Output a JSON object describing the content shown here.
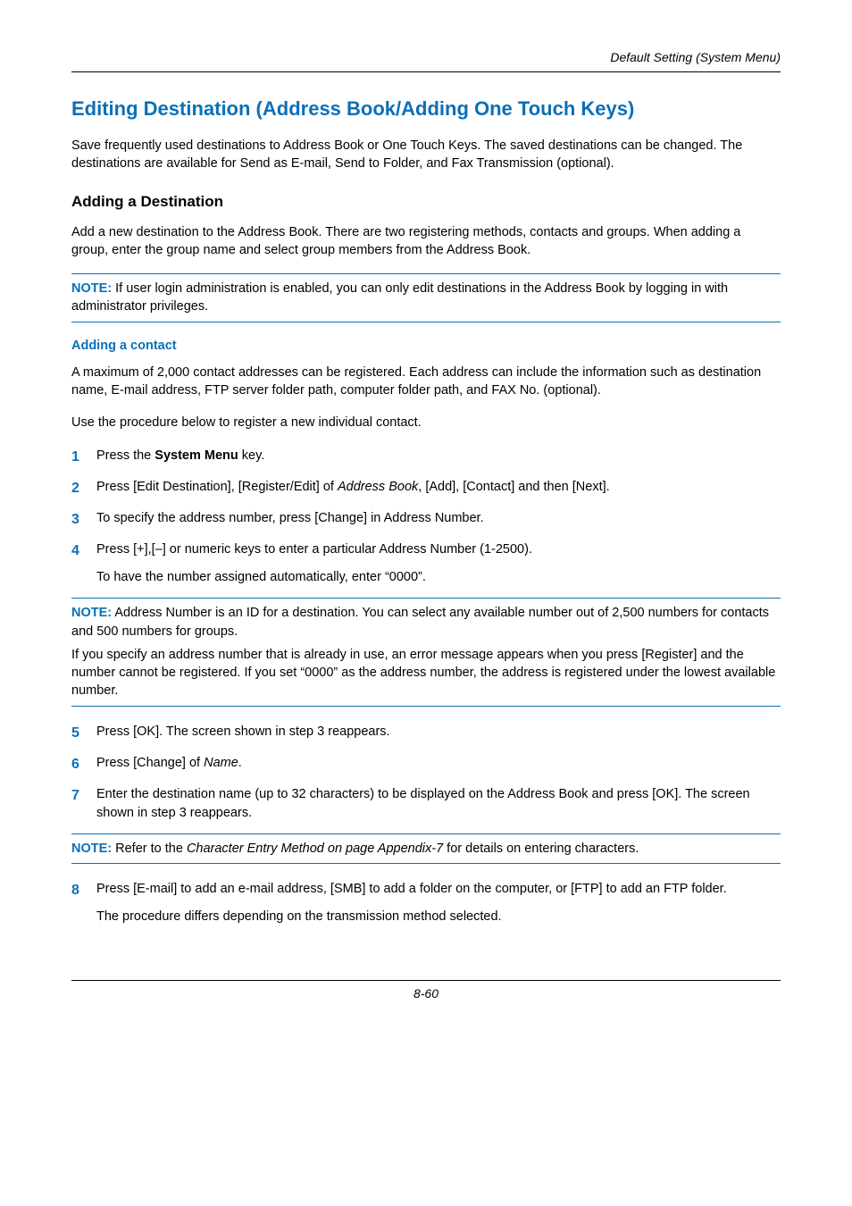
{
  "running_header": "Default Setting (System Menu)",
  "title": "Editing Destination (Address Book/Adding One Touch Keys)",
  "intro": "Save frequently used destinations to Address Book or One Touch Keys. The saved destinations can be changed. The destinations are available for Send as E-mail, Send to Folder, and Fax Transmission (optional).",
  "sub_title": "Adding a Destination",
  "sub_intro": "Add a new destination to the Address Book. There are two registering methods, contacts and groups. When adding a group, enter the group name and select group members from the Address Book.",
  "note1_label": "NOTE:",
  "note1_text": " If user login administration is enabled, you can only edit destinations in the Address Book by logging in with administrator privileges.",
  "blue_sub": "Adding a contact",
  "contact_p1": "A maximum of 2,000 contact addresses can be registered. Each address can include the information such as destination name, E-mail address, FTP server folder path, computer folder path, and FAX No. (optional).",
  "contact_p2": "Use the procedure below to register a new individual contact.",
  "steps_a": {
    "1": {
      "pre": "Press the ",
      "bold": "System Menu",
      "post": " key."
    },
    "2": {
      "pre": "Press [Edit Destination], [Register/Edit] of ",
      "ital": "Address Book",
      "post": ", [Add], [Contact] and then [Next]."
    },
    "3": "To specify the address number, press [Change] in Address Number.",
    "4_p1": "Press [+],[–] or numeric keys to enter a particular Address Number (1-2500).",
    "4_p2": "To have the number assigned automatically, enter “0000”."
  },
  "note2_label": "NOTE:",
  "note2_p1": " Address Number is an ID for a destination. You can select any available number out of 2,500 numbers for contacts and 500 numbers for groups.",
  "note2_p2": "If you specify an address number that is already in use, an error message appears when you press [Register] and the number cannot be registered. If you set “0000” as the address number, the address is registered under the lowest available number.",
  "steps_b": {
    "5": "Press [OK]. The screen shown in step 3 reappears.",
    "6": {
      "pre": "Press [Change] of ",
      "ital": "Name",
      "post": "."
    },
    "7": "Enter the destination name (up to 32 characters) to be displayed on the Address Book and press [OK]. The screen shown in step 3 reappears."
  },
  "note3_label": "NOTE:",
  "note3_pre": " Refer to the ",
  "note3_ital": "Character Entry Method on page Appendix-7",
  "note3_post": " for details on entering characters.",
  "steps_c": {
    "8_p1": "Press [E-mail] to add an e-mail address, [SMB] to add a folder on the computer, or [FTP] to add an FTP folder.",
    "8_p2": "The procedure differs depending on the transmission method selected."
  },
  "page_number": "8-60"
}
